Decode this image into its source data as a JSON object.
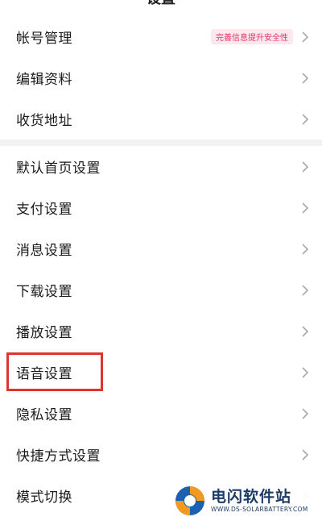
{
  "header": {
    "title": "设置"
  },
  "group1": {
    "items": [
      {
        "label": "帐号管理",
        "badge": "完善信息提升安全性"
      },
      {
        "label": "编辑资料"
      },
      {
        "label": "收货地址"
      }
    ]
  },
  "group2": {
    "items": [
      {
        "label": "默认首页设置"
      },
      {
        "label": "支付设置"
      },
      {
        "label": "消息设置"
      },
      {
        "label": "下载设置"
      },
      {
        "label": "播放设置"
      },
      {
        "label": "语音设置"
      },
      {
        "label": "隐私设置"
      },
      {
        "label": "快捷方式设置"
      },
      {
        "label": "模式切换"
      }
    ]
  },
  "watermark": {
    "title": "电闪软件站",
    "url": "WWW.DS-SOLARBATTERY.COM"
  },
  "colors": {
    "accent": "#e0356a",
    "highlight_border": "#e0322f",
    "chevron": "#a8a8a8",
    "separator": "#f2f2f2"
  },
  "icons": {
    "chevron": "chevron-right-icon",
    "watermark_logo": "ds-logo-icon"
  }
}
